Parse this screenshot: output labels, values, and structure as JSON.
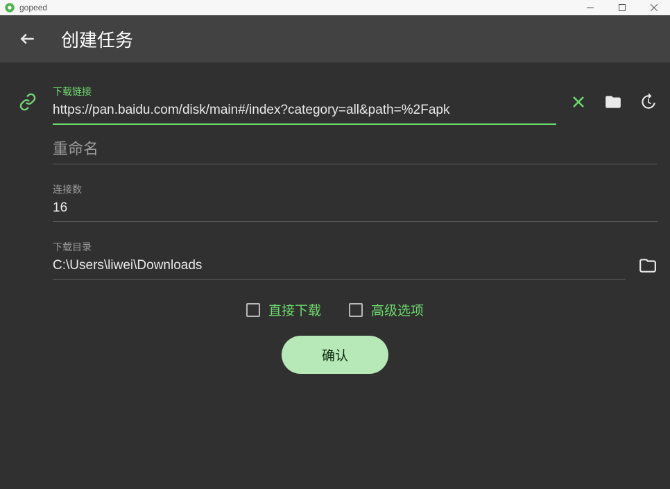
{
  "window": {
    "app_name": "gopeed"
  },
  "header": {
    "title": "创建任务"
  },
  "fields": {
    "url_label": "下载链接",
    "url_value": "https://pan.baidu.com/disk/main#/index?category=all&path=%2Fapk",
    "rename_placeholder": "重命名",
    "connections_label": "连接数",
    "connections_value": "16",
    "path_label": "下载目录",
    "path_value": "C:\\Users\\liwei\\Downloads"
  },
  "options": {
    "direct_download": "直接下载",
    "advanced_options": "高级选项"
  },
  "buttons": {
    "confirm": "确认"
  }
}
